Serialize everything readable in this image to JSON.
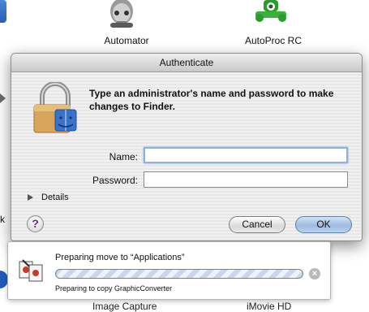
{
  "finder": {
    "apps": [
      {
        "label": "Automator"
      },
      {
        "label": "AutoProc RC"
      }
    ],
    "bottom_labels": [
      "Image Capture",
      "iMovie HD"
    ],
    "left_edge_glyph": "k"
  },
  "auth_dialog": {
    "title": "Authenticate",
    "message": "Type an administrator's name and password to make changes to Finder.",
    "name_label": "Name:",
    "name_value": "",
    "password_label": "Password:",
    "password_value": "",
    "details_label": "Details",
    "help_label": "?",
    "cancel_label": "Cancel",
    "ok_label": "OK",
    "icon": "lock-finder-icon"
  },
  "copy_progress": {
    "title": "Preparing move to “Applications”",
    "status": "Preparing to copy GraphicConverter",
    "progress_state": "indeterminate",
    "stop_label": "×"
  },
  "colors": {
    "focus_ring": "#8fb1dc",
    "default_button": "#9fbbe0",
    "help_mark": "#6a2b86"
  }
}
